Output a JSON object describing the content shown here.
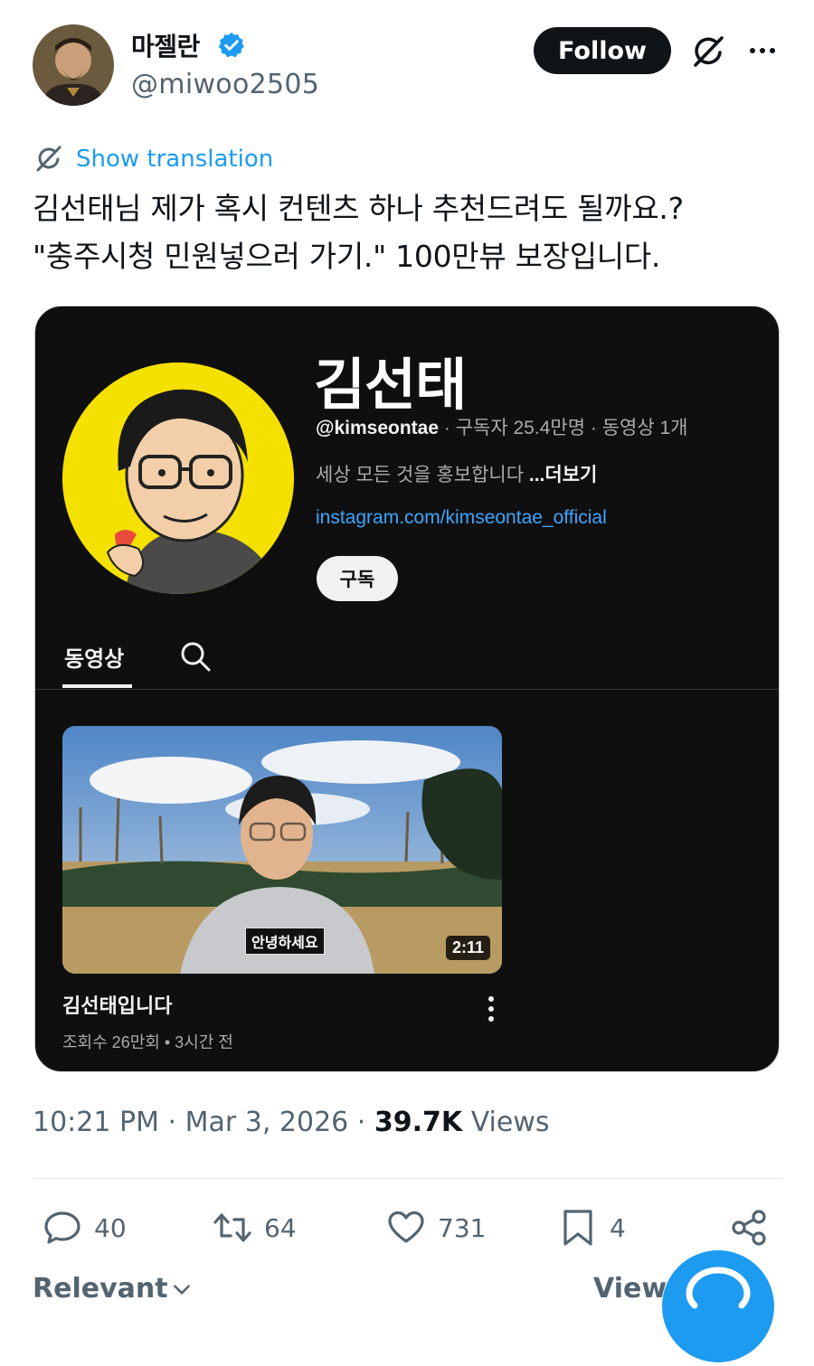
{
  "author": {
    "display_name": "마젤란",
    "handle": "@miwoo2505",
    "verified": true,
    "avatar_icon": "portrait-avatar"
  },
  "header": {
    "follow_label": "Follow",
    "grok_icon": "grok-slash-icon",
    "more_icon": "more-dots-icon"
  },
  "translate": {
    "label": "Show translation",
    "icon": "grok-slash-icon"
  },
  "tweet": {
    "lines": [
      "김선태님 제가 혹시 컨텐츠 하나 추천드려도 될까요.?",
      "\"충주시청 민원넣으러 가기.\" 100만뷰 보장입니다."
    ]
  },
  "embed": {
    "channel_name": "김선태",
    "channel_handle": "@kimseontae",
    "subscribers": "구독자 25.4만명",
    "video_count": "동영상 1개",
    "description": "세상 모든 것을 홍보합니다",
    "description_more": "...더보기",
    "link": "instagram.com/kimseontae_official",
    "subscribe_label": "구독",
    "tab_videos": "동영상",
    "video": {
      "title": "김선태입니다",
      "views": "조회수 26만회",
      "age": "3시간 전",
      "duration": "2:11",
      "caption": "안녕하세요"
    }
  },
  "meta": {
    "time": "10:21 PM",
    "date": "Mar 3, 2026",
    "views_count": "39.7K",
    "views_label": "Views"
  },
  "actions": {
    "replies": "40",
    "reposts": "64",
    "likes": "731",
    "bookmarks": "4"
  },
  "bottom": {
    "sort_label": "Relevant",
    "view_label": "View"
  },
  "colors": {
    "accent": "#1d9bf0",
    "text": "#0f1419",
    "muted": "#536471",
    "card_bg": "#0f0f0f",
    "avatar_yellow": "#f5e100"
  }
}
